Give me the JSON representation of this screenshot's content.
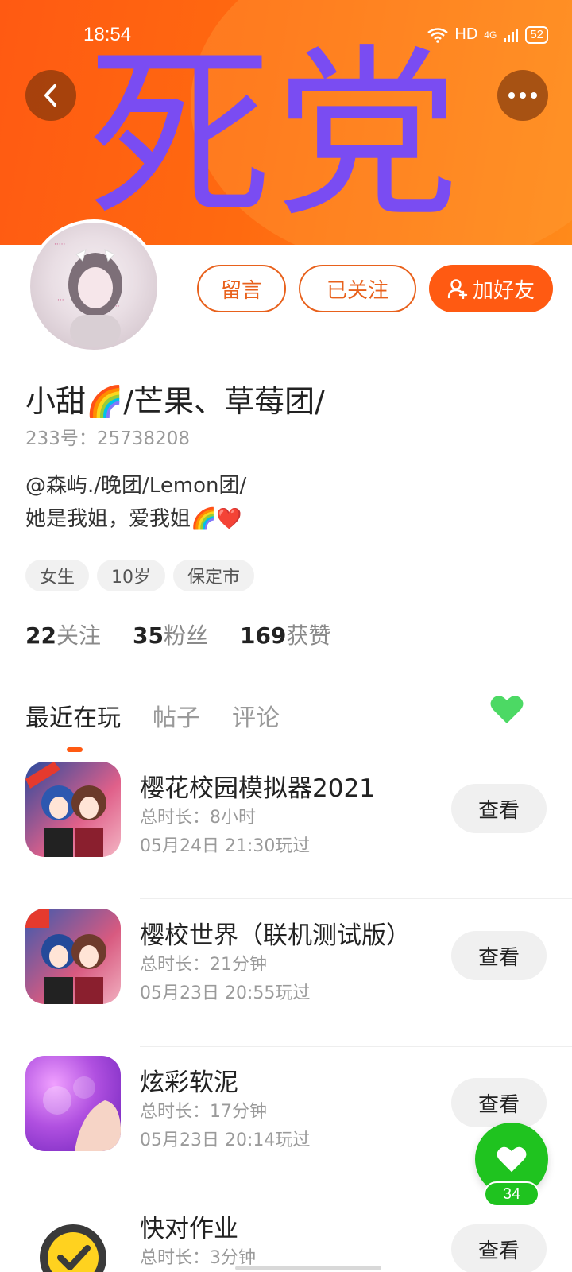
{
  "status_bar": {
    "time": "18:54",
    "network": "HD",
    "signal": "4G",
    "battery": "52"
  },
  "banner": {
    "title": "死党"
  },
  "actions": {
    "message": "留言",
    "following": "已关注",
    "add_friend": "加好友"
  },
  "profile": {
    "name": "小甜🌈/芒果、草莓团/",
    "uid": "233号：25738208",
    "bio_line1": "@森屿./晚团/Lemon团/",
    "bio_line2": "她是我姐，爱我姐🌈❤️",
    "tags": [
      "女生",
      "10岁",
      "保定市"
    ]
  },
  "stats": [
    {
      "num": "22",
      "label": "关注"
    },
    {
      "num": "35",
      "label": "粉丝"
    },
    {
      "num": "169",
      "label": "获赞"
    }
  ],
  "tabs": [
    "最近在玩",
    "帖子",
    "评论"
  ],
  "games": [
    {
      "title": "樱花校园模拟器2021",
      "duration": "总时长：8小时",
      "last_played": "05月24日 21:30玩过",
      "button": "查看"
    },
    {
      "title": "樱校世界（联机测试版）",
      "duration": "总时长：21分钟",
      "last_played": "05月23日 20:55玩过",
      "button": "查看"
    },
    {
      "title": "炫彩软泥",
      "duration": "总时长：17分钟",
      "last_played": "05月23日 20:14玩过",
      "button": "查看"
    },
    {
      "title": "快对作业",
      "duration": "总时长：3分钟",
      "last_played": "",
      "button": "查看"
    }
  ],
  "fab": {
    "count": "34"
  },
  "colors": {
    "brand": "#ff5a12",
    "banner_text": "#7a4cf2",
    "like": "#1fc31f",
    "tab_heart": "#4cd964"
  }
}
